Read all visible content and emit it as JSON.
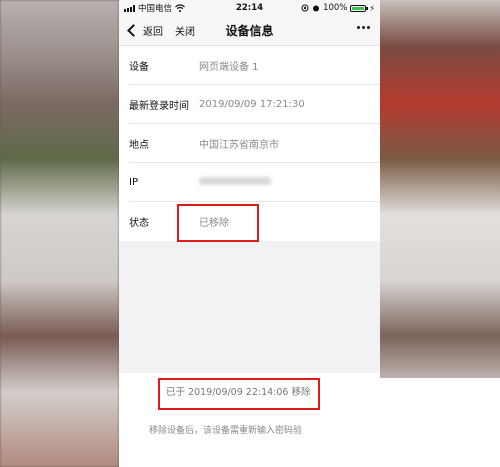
{
  "status_bar": {
    "carrier": "中国电信",
    "time": "22:14",
    "battery_percent": "100%"
  },
  "nav": {
    "back_label": "返回",
    "close_label": "关闭",
    "title": "设备信息"
  },
  "device_info": [
    {
      "label": "设备",
      "value": "网页端设备 1"
    },
    {
      "label": "最新登录时间",
      "value": "2019/09/09 17:21:30"
    },
    {
      "label": "地点",
      "value": "中国江苏省南京市"
    },
    {
      "label": "IP",
      "value": ""
    },
    {
      "label": "状态",
      "value": "已移除"
    }
  ],
  "removed_note": "已于 2019/09/09 22:14:06 移除",
  "footer_note": "移除设备后，该设备需重新输入密码验",
  "colors": {
    "highlight": "#e11a1a",
    "battery": "#3bc24a"
  }
}
